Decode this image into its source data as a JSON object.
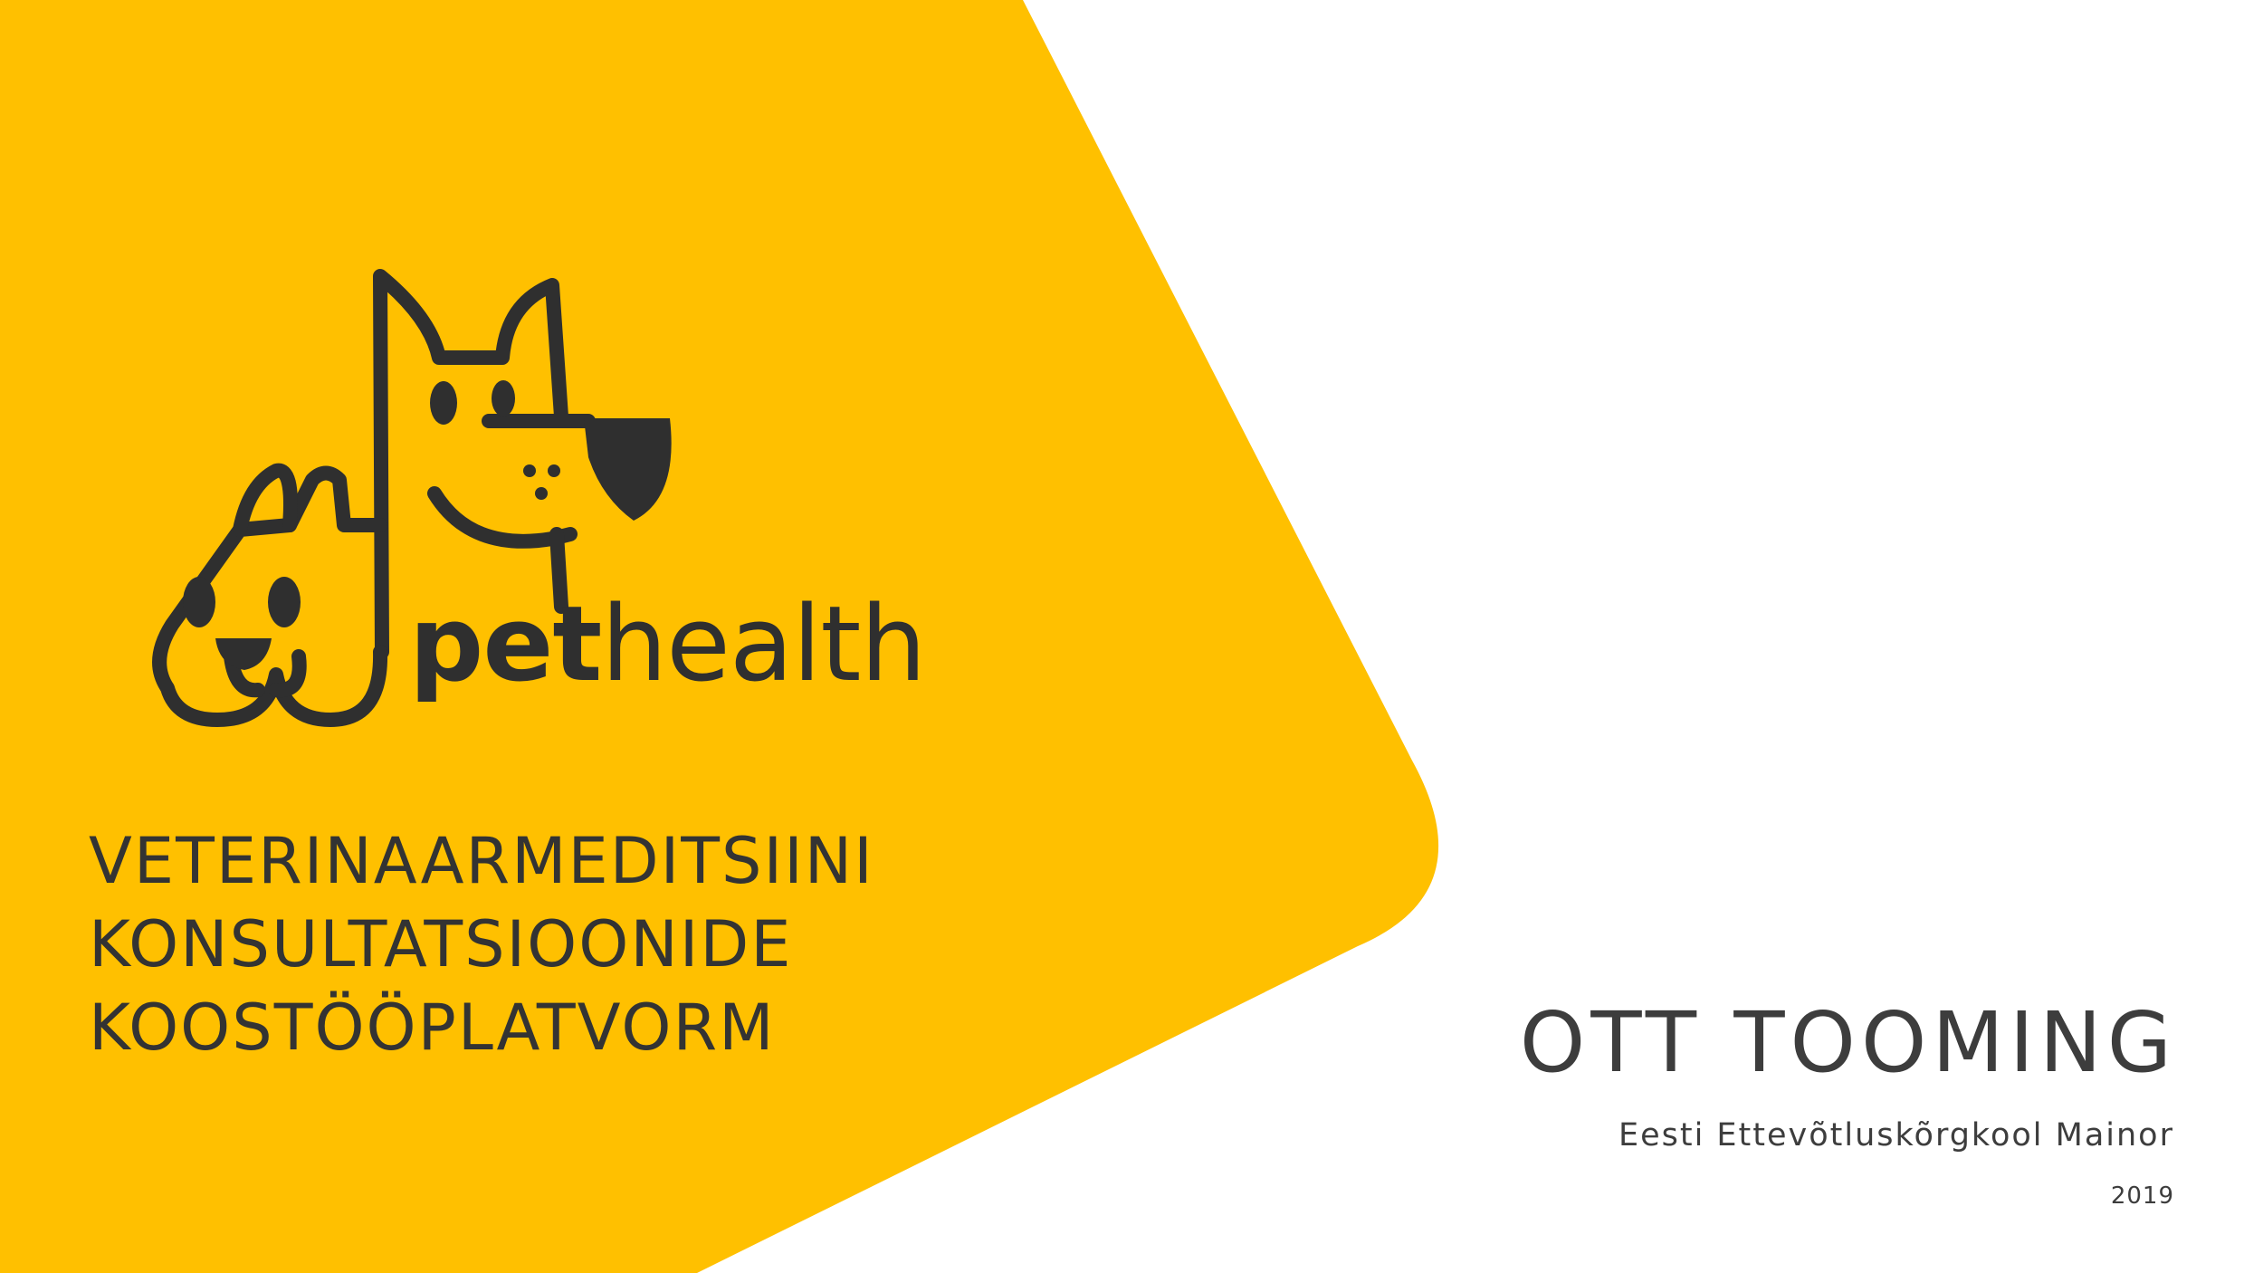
{
  "colors": {
    "brand_yellow": "#FFC000",
    "ink": "#2F2F2F",
    "background": "#FFFFFF"
  },
  "logo": {
    "icon": "cat-and-dog-icon",
    "wordmark_bold": "pet",
    "wordmark_light": "health"
  },
  "subtitle": {
    "lines": [
      "VETERINAARMEDITSIINI",
      "KONSULTATSIOONIDE",
      "KOOSTÖÖPLATVORM"
    ]
  },
  "author": "OTT TOOMING",
  "school": "Eesti Ettevõtluskõrgkool Mainor",
  "year": "2019"
}
